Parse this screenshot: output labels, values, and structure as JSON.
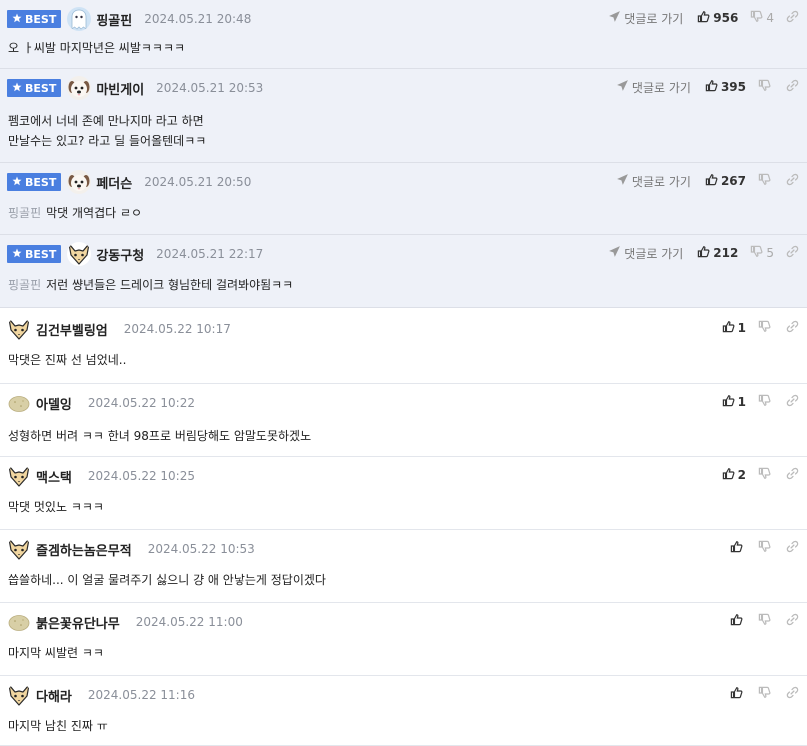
{
  "best_label": "BEST",
  "reply_label": "댓글로 가기",
  "comments": [
    {
      "best": true,
      "avatar": "ghost",
      "nick": "핑골핀",
      "date": "2024.05.21 20:48",
      "mention": "",
      "text": "오 ㅏ씨발 마지막년은 씨발ㅋㅋㅋㅋ",
      "likes": "956",
      "dislikes": "4"
    },
    {
      "best": true,
      "avatar": "dog",
      "nick": "마빈게이",
      "date": "2024.05.21 20:53",
      "mention": "",
      "text": "펨코에서 너네 존예 만나지마 라고 하면\n만날수는 있고? 라고 딜 들어올텐데ㅋㅋ",
      "likes": "395",
      "dislikes": ""
    },
    {
      "best": true,
      "avatar": "dog",
      "nick": "페더슨",
      "date": "2024.05.21 20:50",
      "mention": "핑골핀",
      "text": "막댓 개역겹다 ㄹㅇ",
      "likes": "267",
      "dislikes": ""
    },
    {
      "best": true,
      "avatar": "fox",
      "nick": "강동구청",
      "date": "2024.05.21 22:17",
      "mention": "핑골핀",
      "text": "저런 썅년들은 드레이크 형님한테 걸려봐야됨ㅋㅋ",
      "likes": "212",
      "dislikes": "5"
    },
    {
      "best": false,
      "avatar": "fox",
      "nick": "김건부벨링엄",
      "date": "2024.05.22 10:17",
      "mention": "",
      "text": "막댓은 진짜 선 넘었네..",
      "likes": "1",
      "dislikes": ""
    },
    {
      "best": false,
      "avatar": "potato",
      "nick": "아델잉",
      "date": "2024.05.22 10:22",
      "mention": "",
      "text": "성형하면 버려 ㅋㅋ 한녀 98프로 버림당해도 암말도못하겠노",
      "likes": "1",
      "dislikes": ""
    },
    {
      "best": false,
      "avatar": "fox",
      "nick": "맥스택",
      "date": "2024.05.22 10:25",
      "mention": "",
      "text": "막댓 멋있노 ㅋㅋㅋ",
      "likes": "2",
      "dislikes": ""
    },
    {
      "best": false,
      "avatar": "fox",
      "nick": "즐겜하는놈은무적",
      "date": "2024.05.22 10:53",
      "mention": "",
      "text": "씁쓸하네... 이 얼굴 물려주기 싫으니 걍 애 안낳는게 정답이겠다",
      "likes": "",
      "dislikes": ""
    },
    {
      "best": false,
      "avatar": "potato",
      "nick": "붉은꽃유단나무",
      "date": "2024.05.22 11:00",
      "mention": "",
      "text": "마지막 씨발련 ㅋㅋ",
      "likes": "",
      "dislikes": ""
    },
    {
      "best": false,
      "avatar": "fox",
      "nick": "다해라",
      "date": "2024.05.22 11:16",
      "mention": "",
      "text": "마지막 남친 진짜 ㅠ",
      "likes": "",
      "dislikes": ""
    }
  ]
}
